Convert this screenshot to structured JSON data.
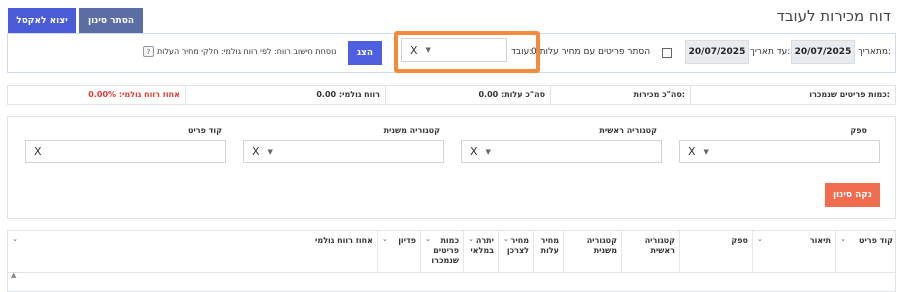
{
  "header": {
    "title": "דוח מכירות לעובד",
    "hide_filter_label": "הסתר סינון",
    "export_label": "יצוא לאקסל"
  },
  "filter_bar": {
    "from_label": "מתאריך:",
    "from_value": "20/07/2025",
    "to_label": "עד תאריך:",
    "to_value": "20/07/2025",
    "hide_cost_items_label": "הסתר פריטים עם מחיר עלות 0",
    "employee_label": "עובד:",
    "employee_value": "X",
    "show_label": "הצג",
    "profit_formula_text": "נוסחת חישוב רווח: לפי רווח גולמי: חלקי מחיר העלות",
    "help_glyph": "?"
  },
  "summary": {
    "items_sold": "כמות פריטים שנמכרו:",
    "total_sales": "סה\"כ מכירות:",
    "total_cost": "סה\"כ עלות: 0.00",
    "gross_profit": "רווח גולמי: 0.00",
    "gross_profit_pct": "אחוז רווח גולמי: 0.00%"
  },
  "filters_panel": {
    "supplier_label": "ספק",
    "supplier_value": "X",
    "main_category_label": "קטגוריה ראשית",
    "main_category_value": "X",
    "sub_category_label": "קטגוריה משנית",
    "sub_category_value": "X",
    "item_code_label": "קוד פריט",
    "item_code_value": "X",
    "clear_filter_label": "נקה סינון"
  },
  "grid": {
    "columns": [
      "קוד פריט",
      "תיאור",
      "ספק",
      "קטגוריה\nראשית",
      "קטגוריה\nמשנית",
      "מחיר\nעלות",
      "מחיר\nלצרכן",
      "יתרה\nבמלאי",
      "כמות\nפריטים\nשנמכרו",
      "פדיון",
      "אחוז רווח גולמי"
    ],
    "chevron": "⌄",
    "scroll_up": "▲"
  },
  "icons": {
    "caret": "▼"
  },
  "colors": {
    "export_button": "#4a5bd8",
    "hide_filter_button": "#5a6ea5",
    "show_button": "#4e5fe0",
    "clear_button": "#f26c4f",
    "highlight_frame": "#f58a3c",
    "profit_pct_text": "#e53935"
  }
}
